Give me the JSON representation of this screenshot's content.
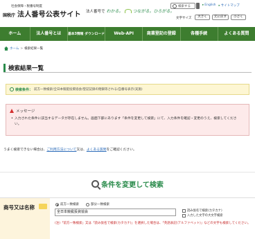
{
  "header": {
    "logo_small": "社会保障・税番号制度",
    "logo_agency": "国税庁",
    "logo_title": "法人番号公表サイト",
    "tagline_1": "法人番号で",
    "tagline_2": "わかる。",
    "tagline_3": "つながる。ひろがる。",
    "search_placeholder": "検索する",
    "lang_links": [
      "English",
      "サイトマップ"
    ],
    "font_size_label": "文字サイズ",
    "font_size_buttons": [
      "大きく",
      "元に戻す",
      "小さく"
    ]
  },
  "nav": {
    "items": [
      "ホーム",
      "法人番号とは",
      "基本3情報 ダウンロード",
      "Web-API",
      "商業登記の登録",
      "各種手続",
      "よくある質問"
    ]
  },
  "breadcrumb": {
    "home": "ホーム",
    "separator": ">",
    "current": "検索結果一覧"
  },
  "page": {
    "title": "検索結果一覧"
  },
  "condition": {
    "label": "検索条件：",
    "text": "前方一致検索/全日本競艇投資協会/登記記録の閉鎖等される/自番号表示(実施)"
  },
  "message": {
    "title": "メッセージ",
    "body": "入力された条件に該当するデータが存在しません。画面下部にあります「条件を変更して検索」にて、入力条件を確認・変更のうえ、検索してください。"
  },
  "help": {
    "prefix": "うまく検索できない場合は、",
    "link1": "ご利用方法について",
    "mid": "又は、",
    "link2": "よくある質問",
    "suffix": "をご確認ください。"
  },
  "change": {
    "heading": "条件を変更して検索"
  },
  "form": {
    "name_label": "商号又は名称",
    "radio_options": [
      "前方一致検索",
      "部分一致検索"
    ],
    "radio_selected": 0,
    "name_value": "全日本競艇投資協会",
    "checkboxes": [
      "読み仮名で検索(カタカナ)",
      "入力した文字の大文字検索"
    ],
    "note": "(注)「前方一致検索」又は「読み仮名で検索(カタカナ)」を選択した場合は、「英語表記(アルファベット)」などの文字も検索してください。"
  }
}
